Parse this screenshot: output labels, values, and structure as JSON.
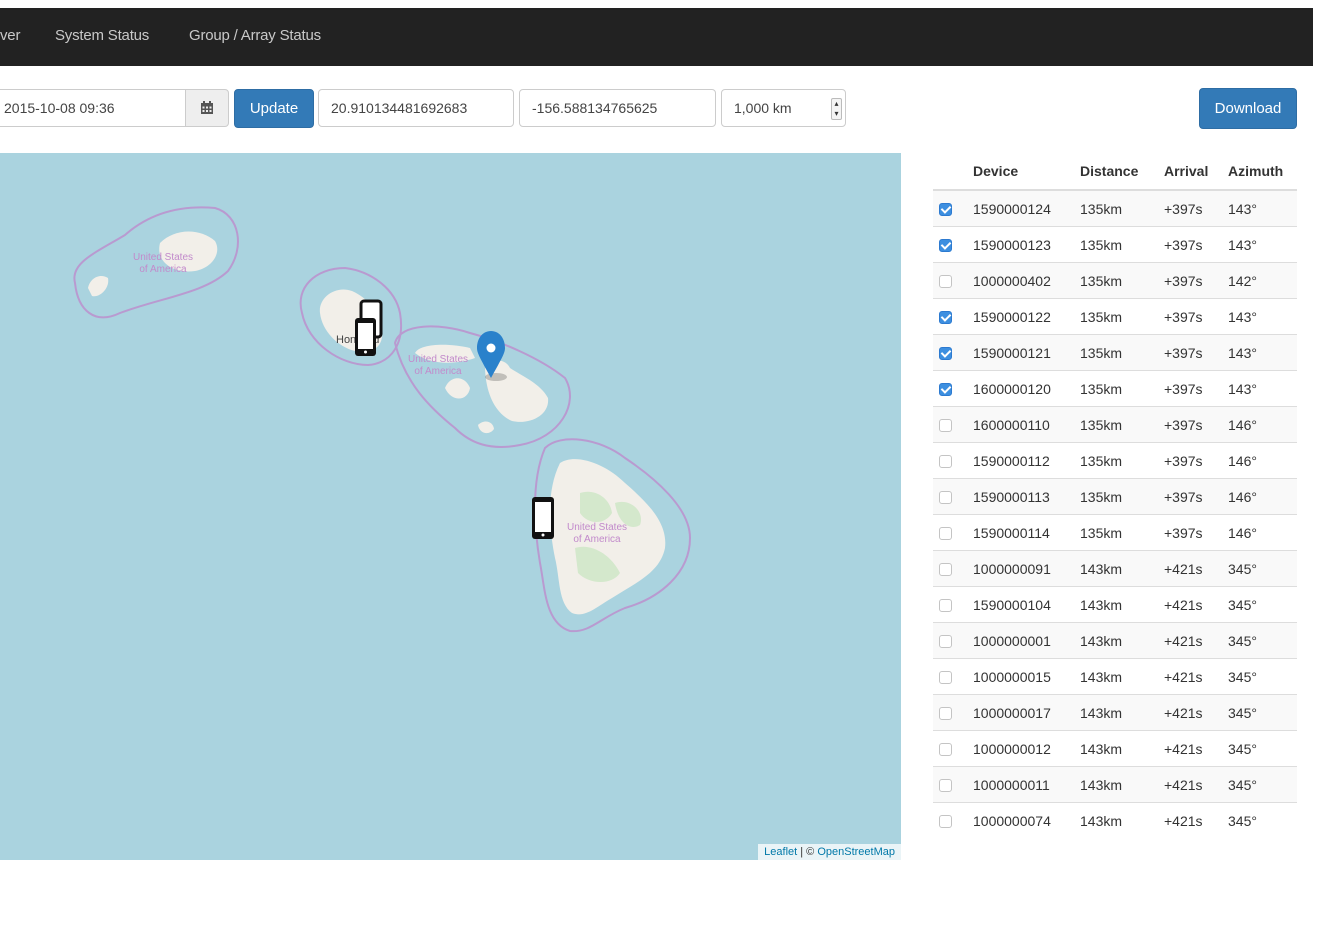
{
  "nav": {
    "brand": "ver",
    "links": [
      "System Status",
      "Group / Array Status"
    ]
  },
  "toolbar": {
    "datetime": "2015-10-08 09:36",
    "update_label": "Update",
    "latitude": "20.910134481692683",
    "longitude": "-156.588134765625",
    "range": "1,000 km",
    "download_label": "Download"
  },
  "map": {
    "labels": [
      "United States of America",
      "United States of America",
      "United States of America",
      "United States of America",
      "Honolulu"
    ],
    "attribution_leaflet": "Leaflet",
    "attribution_sep": " | © ",
    "attribution_osm": "OpenStreetMap"
  },
  "table": {
    "headers": [
      "",
      "Device",
      "Distance",
      "Arrival",
      "Azimuth"
    ],
    "rows": [
      {
        "checked": true,
        "device": "1590000124",
        "distance": "135km",
        "arrival": "+397s",
        "azimuth": "143°"
      },
      {
        "checked": true,
        "device": "1590000123",
        "distance": "135km",
        "arrival": "+397s",
        "azimuth": "143°"
      },
      {
        "checked": false,
        "device": "1000000402",
        "distance": "135km",
        "arrival": "+397s",
        "azimuth": "142°"
      },
      {
        "checked": true,
        "device": "1590000122",
        "distance": "135km",
        "arrival": "+397s",
        "azimuth": "143°"
      },
      {
        "checked": true,
        "device": "1590000121",
        "distance": "135km",
        "arrival": "+397s",
        "azimuth": "143°"
      },
      {
        "checked": true,
        "device": "1600000120",
        "distance": "135km",
        "arrival": "+397s",
        "azimuth": "143°"
      },
      {
        "checked": false,
        "device": "1600000110",
        "distance": "135km",
        "arrival": "+397s",
        "azimuth": "146°"
      },
      {
        "checked": false,
        "device": "1590000112",
        "distance": "135km",
        "arrival": "+397s",
        "azimuth": "146°"
      },
      {
        "checked": false,
        "device": "1590000113",
        "distance": "135km",
        "arrival": "+397s",
        "azimuth": "146°"
      },
      {
        "checked": false,
        "device": "1590000114",
        "distance": "135km",
        "arrival": "+397s",
        "azimuth": "146°"
      },
      {
        "checked": false,
        "device": "1000000091",
        "distance": "143km",
        "arrival": "+421s",
        "azimuth": "345°"
      },
      {
        "checked": false,
        "device": "1590000104",
        "distance": "143km",
        "arrival": "+421s",
        "azimuth": "345°"
      },
      {
        "checked": false,
        "device": "1000000001",
        "distance": "143km",
        "arrival": "+421s",
        "azimuth": "345°"
      },
      {
        "checked": false,
        "device": "1000000015",
        "distance": "143km",
        "arrival": "+421s",
        "azimuth": "345°"
      },
      {
        "checked": false,
        "device": "1000000017",
        "distance": "143km",
        "arrival": "+421s",
        "azimuth": "345°"
      },
      {
        "checked": false,
        "device": "1000000012",
        "distance": "143km",
        "arrival": "+421s",
        "azimuth": "345°"
      },
      {
        "checked": false,
        "device": "1000000011",
        "distance": "143km",
        "arrival": "+421s",
        "azimuth": "345°"
      },
      {
        "checked": false,
        "device": "1000000074",
        "distance": "143km",
        "arrival": "+421s",
        "azimuth": "345°"
      }
    ]
  },
  "colors": {
    "navbar": "#222222",
    "primary": "#337ab7",
    "ocean": "#aad3df",
    "land": "#f2efe9",
    "boundary": "#b99ad0",
    "marker": "#2a81cb",
    "checkbox_on": "#3d8fe0"
  }
}
